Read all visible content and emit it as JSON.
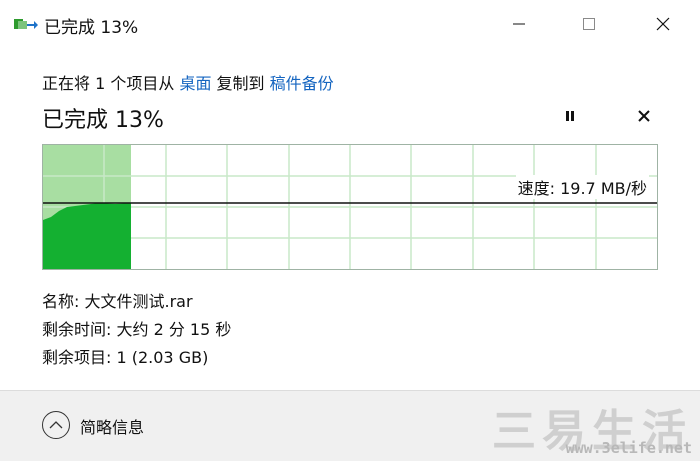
{
  "window": {
    "title": "已完成 13%",
    "controls": {
      "minimize": "—",
      "maximize": "☐",
      "close": "✕"
    }
  },
  "transfer": {
    "prefix": "正在将 1 个项目从 ",
    "source": "桌面",
    "middle": " 复制到 ",
    "destination": "稿件备份",
    "progress_title": "已完成 13%",
    "progress_fraction": 0.13,
    "speed_text": "速度: 19.7 MB/秒"
  },
  "details": {
    "name": "名称: 大文件测试.rar",
    "time_remaining": "剩余时间: 大约 2 分 15 秒",
    "items_remaining": "剩余项目: 1 (2.03 GB)"
  },
  "footer": {
    "toggle_label": "简略信息"
  },
  "watermark": {
    "main": "三易生活",
    "url": "www.3elife.net"
  },
  "colors": {
    "progress_light": "#a8dea2",
    "progress_dark": "#14b031",
    "grid": "#c8e8c8",
    "link": "#1565c0"
  }
}
